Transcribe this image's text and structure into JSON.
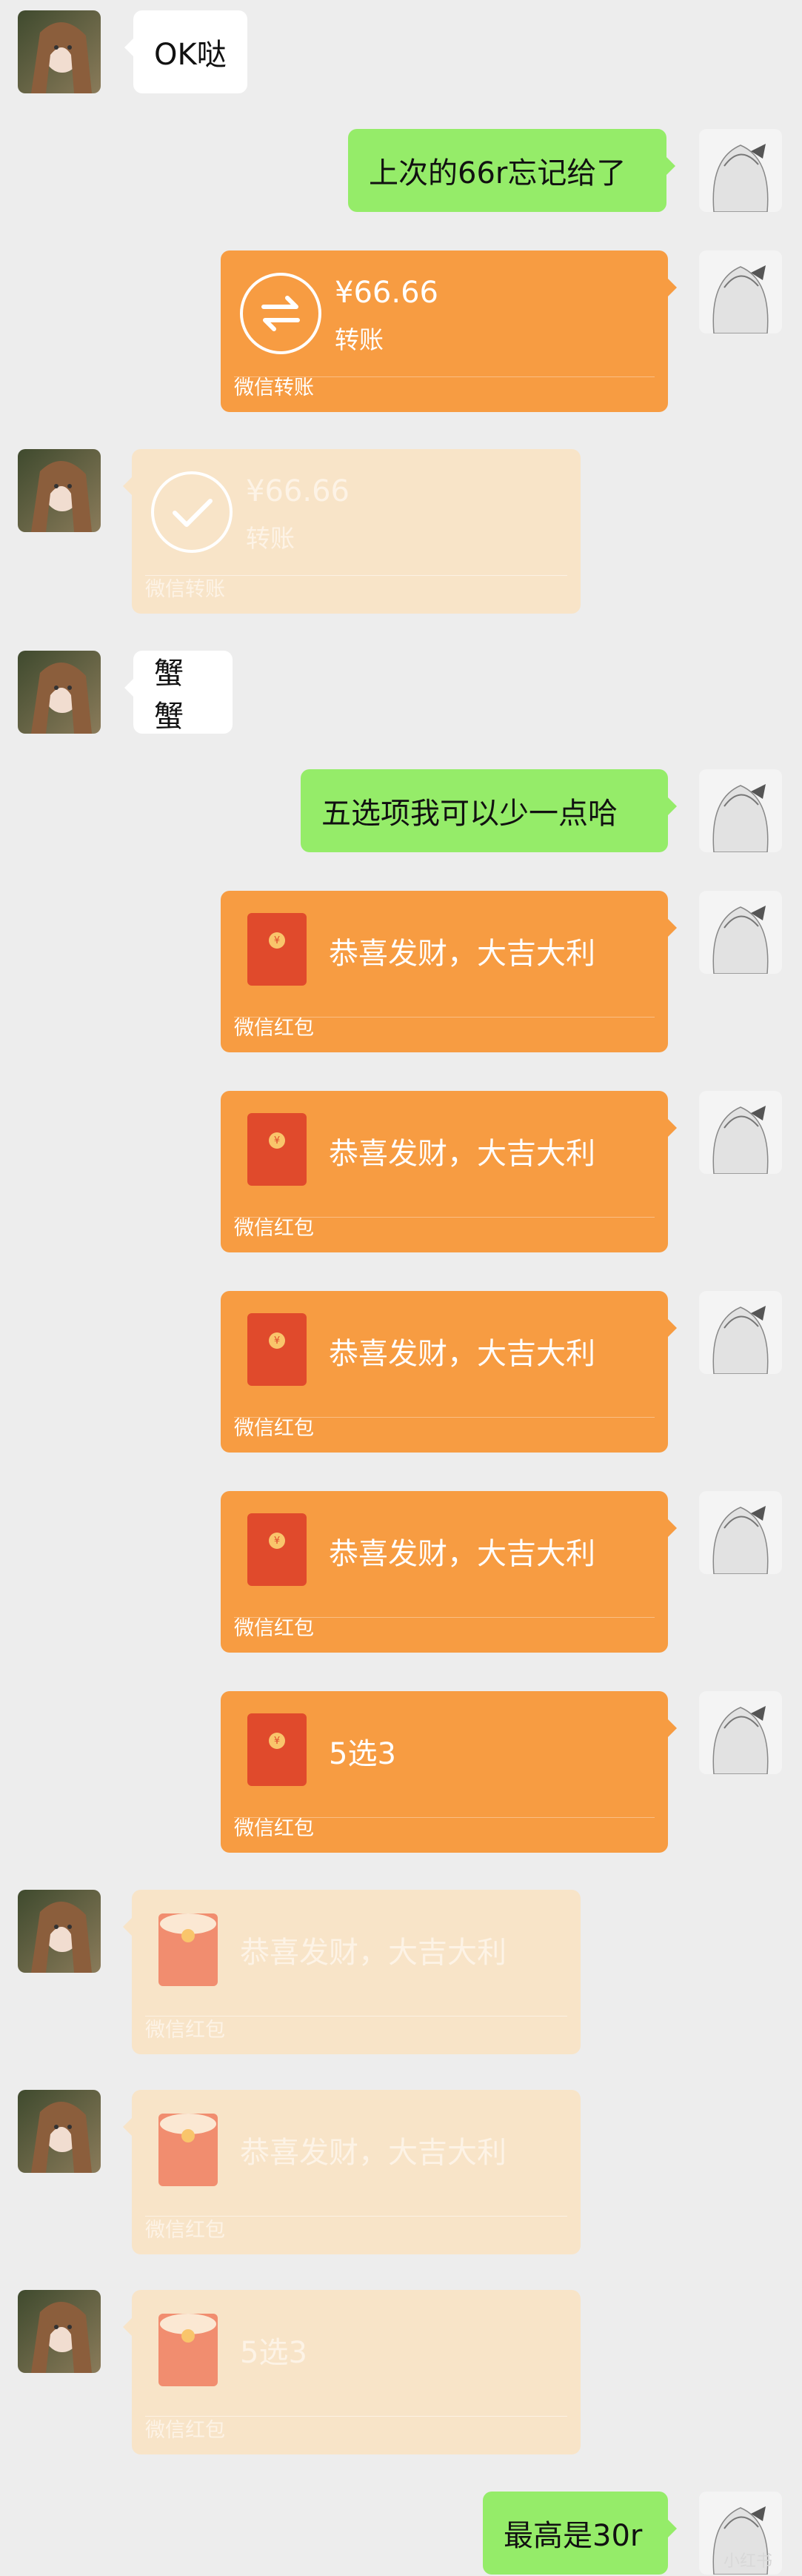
{
  "messages": {
    "m1": {
      "text": "OK哒"
    },
    "m2": {
      "text": "上次的66r忘记给了"
    },
    "t1": {
      "amount": "¥66.66",
      "label": "转账",
      "footer": "微信转账"
    },
    "t2": {
      "amount": "¥66.66",
      "label": "转账",
      "footer": "微信转账"
    },
    "m3": {
      "text": "蟹蟹"
    },
    "m4": {
      "text": "五选项我可以少一点哈"
    },
    "r1": {
      "title": "恭喜发财，大吉大利",
      "footer": "微信红包"
    },
    "r2": {
      "title": "恭喜发财，大吉大利",
      "footer": "微信红包"
    },
    "r3": {
      "title": "恭喜发财，大吉大利",
      "footer": "微信红包"
    },
    "r4": {
      "title": "恭喜发财，大吉大利",
      "footer": "微信红包"
    },
    "r5": {
      "title": "5选3",
      "footer": "微信红包"
    },
    "r6": {
      "title": "恭喜发财，大吉大利",
      "footer": "微信红包"
    },
    "r7": {
      "title": "恭喜发财，大吉大利",
      "footer": "微信红包"
    },
    "r8": {
      "title": "5选3",
      "footer": "微信红包"
    },
    "m5": {
      "text": "最高是30r"
    }
  },
  "watermark": "小红书"
}
